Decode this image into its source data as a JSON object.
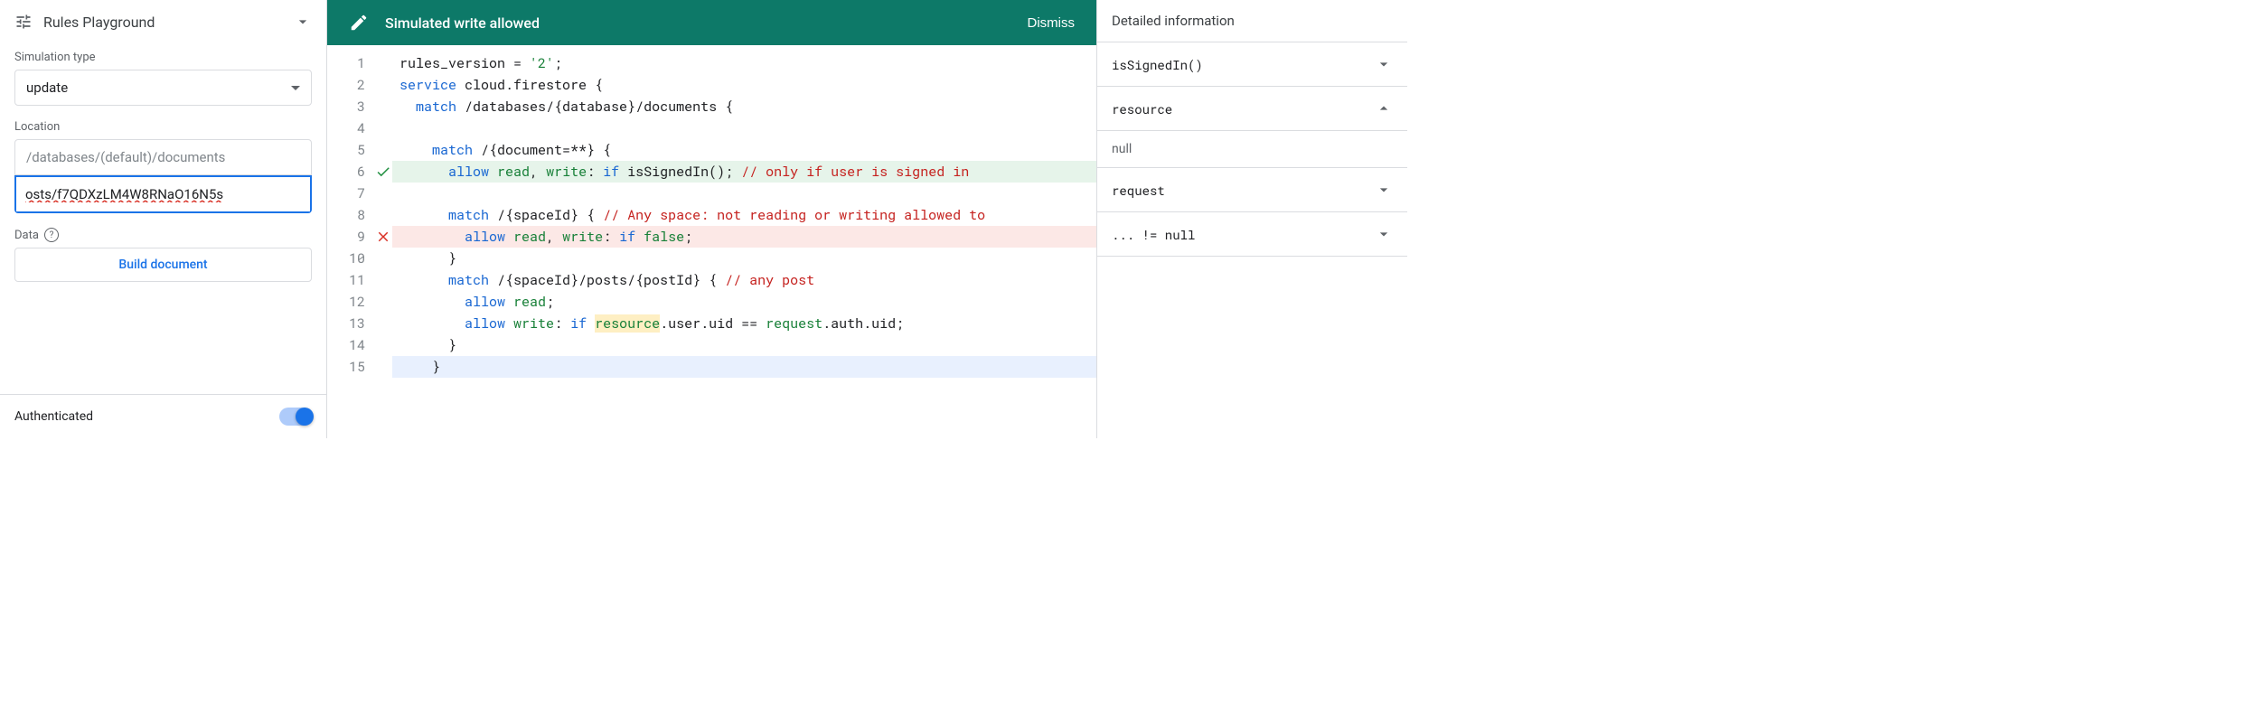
{
  "sidebar": {
    "title": "Rules Playground",
    "simulation_type_label": "Simulation type",
    "simulation_type_value": "update",
    "location_label": "Location",
    "location_placeholder": "/databases/(default)/documents",
    "location_value": "osts/f7QDXzLM4W8RNaO16N5s",
    "data_label": "Data",
    "build_document_label": "Build document",
    "authenticated_label": "Authenticated"
  },
  "banner": {
    "message": "Simulated write allowed",
    "dismiss_label": "Dismiss"
  },
  "editor": {
    "lines": [
      {
        "n": 1,
        "status": "",
        "hl": "",
        "tokens": [
          [
            "",
            "rules_version = "
          ],
          [
            "str",
            "'2'"
          ],
          [
            "",
            ";"
          ]
        ]
      },
      {
        "n": 2,
        "status": "",
        "hl": "",
        "tokens": [
          [
            "kw",
            "service"
          ],
          [
            "",
            " cloud.firestore {"
          ]
        ]
      },
      {
        "n": 3,
        "status": "",
        "hl": "",
        "tokens": [
          [
            "",
            "  "
          ],
          [
            "kw",
            "match"
          ],
          [
            "",
            " /databases/{database}/documents {"
          ]
        ]
      },
      {
        "n": 4,
        "status": "",
        "hl": "",
        "tokens": [
          [
            "",
            ""
          ]
        ]
      },
      {
        "n": 5,
        "status": "",
        "hl": "",
        "tokens": [
          [
            "",
            "    "
          ],
          [
            "kw",
            "match"
          ],
          [
            "",
            " /{document=**} {"
          ]
        ]
      },
      {
        "n": 6,
        "status": "pass",
        "hl": "pass",
        "tokens": [
          [
            "",
            "      "
          ],
          [
            "kw",
            "allow"
          ],
          [
            "",
            " "
          ],
          [
            "str",
            "read"
          ],
          [
            "",
            ", "
          ],
          [
            "str",
            "write"
          ],
          [
            "",
            ": "
          ],
          [
            "kw",
            "if"
          ],
          [
            "",
            " isSignedIn(); "
          ],
          [
            "cmt",
            "// only if user is signed in"
          ]
        ]
      },
      {
        "n": 7,
        "status": "",
        "hl": "",
        "tokens": [
          [
            "",
            ""
          ]
        ]
      },
      {
        "n": 8,
        "status": "",
        "hl": "",
        "tokens": [
          [
            "",
            "      "
          ],
          [
            "kw",
            "match"
          ],
          [
            "",
            " /{spaceId} { "
          ],
          [
            "cmt",
            "// Any space: not reading or writing allowed to"
          ]
        ]
      },
      {
        "n": 9,
        "status": "fail",
        "hl": "fail",
        "tokens": [
          [
            "",
            "        "
          ],
          [
            "kw",
            "allow"
          ],
          [
            "",
            " "
          ],
          [
            "str",
            "read"
          ],
          [
            "",
            ", "
          ],
          [
            "str",
            "write"
          ],
          [
            "",
            ": "
          ],
          [
            "kw",
            "if"
          ],
          [
            "",
            " "
          ],
          [
            "str",
            "false"
          ],
          [
            "",
            ";"
          ]
        ]
      },
      {
        "n": 10,
        "status": "",
        "hl": "",
        "tokens": [
          [
            "",
            "      }"
          ]
        ]
      },
      {
        "n": 11,
        "status": "",
        "hl": "",
        "tokens": [
          [
            "",
            "      "
          ],
          [
            "kw",
            "match"
          ],
          [
            "",
            " /{spaceId}/posts/{postId} { "
          ],
          [
            "cmt",
            "// any post"
          ]
        ]
      },
      {
        "n": 12,
        "status": "",
        "hl": "",
        "tokens": [
          [
            "",
            "        "
          ],
          [
            "kw",
            "allow"
          ],
          [
            "",
            " "
          ],
          [
            "str",
            "read"
          ],
          [
            "",
            ";"
          ]
        ]
      },
      {
        "n": 13,
        "status": "",
        "hl": "",
        "tokens": [
          [
            "",
            "        "
          ],
          [
            "kw",
            "allow"
          ],
          [
            "",
            " "
          ],
          [
            "str",
            "write"
          ],
          [
            "",
            ": "
          ],
          [
            "kw",
            "if"
          ],
          [
            "",
            " "
          ],
          [
            "hlw",
            "resource"
          ],
          [
            "",
            ".user.uid == "
          ],
          [
            "str",
            "request"
          ],
          [
            "",
            ".auth.uid;"
          ]
        ]
      },
      {
        "n": 14,
        "status": "",
        "hl": "",
        "tokens": [
          [
            "",
            "      }"
          ]
        ]
      },
      {
        "n": 15,
        "status": "",
        "hl": "cursor",
        "tokens": [
          [
            "",
            "    }"
          ]
        ]
      }
    ]
  },
  "details": {
    "header": "Detailed information",
    "items": [
      {
        "key": "isSignedIn()",
        "expanded": false
      },
      {
        "key": "resource",
        "expanded": true,
        "content": "null"
      },
      {
        "key": "request",
        "expanded": false
      },
      {
        "key": "... != null",
        "expanded": false
      }
    ]
  }
}
